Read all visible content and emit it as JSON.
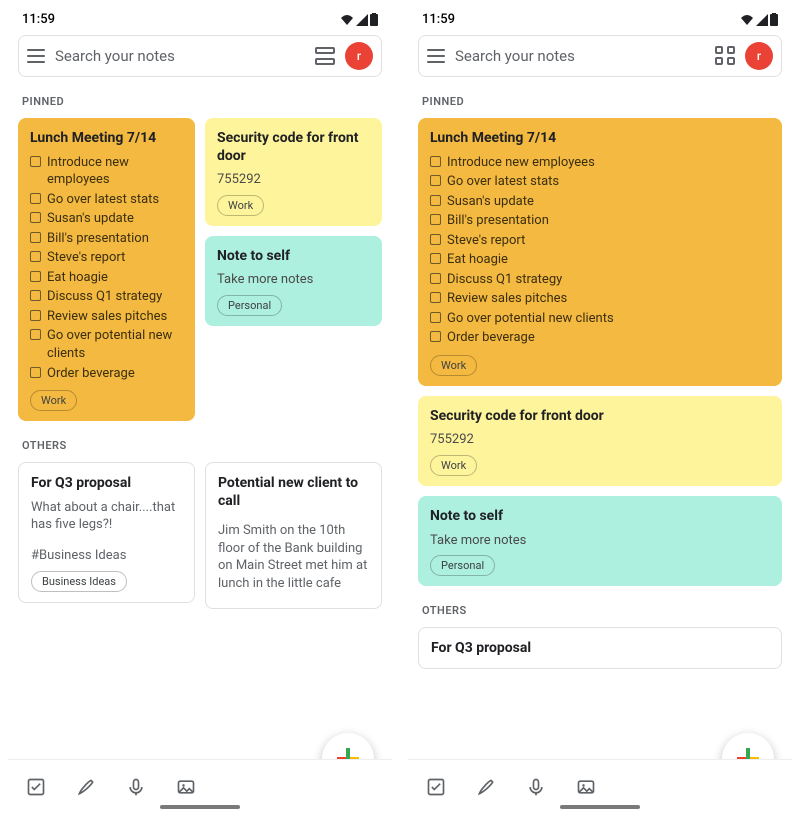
{
  "status": {
    "time": "11:59"
  },
  "search": {
    "placeholder": "Search your notes"
  },
  "avatar": {
    "letter": "r"
  },
  "sections": {
    "pinned": "PINNED",
    "others": "OTHERS"
  },
  "notes": {
    "lunch": {
      "title": "Lunch Meeting 7/14",
      "items": [
        "Introduce new employees",
        "Go over latest stats",
        "Susan's update",
        "Bill's presentation",
        "Steve's report",
        "Eat hoagie",
        "Discuss Q1 strategy",
        "Review sales pitches",
        "Go over potential new clients",
        "Order beverage"
      ],
      "chip": "Work"
    },
    "security": {
      "title": "Security code for front door",
      "body": "755292",
      "chip": "Work"
    },
    "self": {
      "title": "Note to self",
      "body": "Take more notes",
      "chip": "Personal"
    },
    "q3": {
      "title": "For Q3 proposal",
      "body": "What about a chair....that has five legs?!",
      "hash": "#Business Ideas",
      "chip": "Business Ideas"
    },
    "client": {
      "title": "Potential new client to call",
      "body": "Jim Smith on the 10th floor of the Bank building on Main Street met him at lunch in the little cafe"
    }
  }
}
